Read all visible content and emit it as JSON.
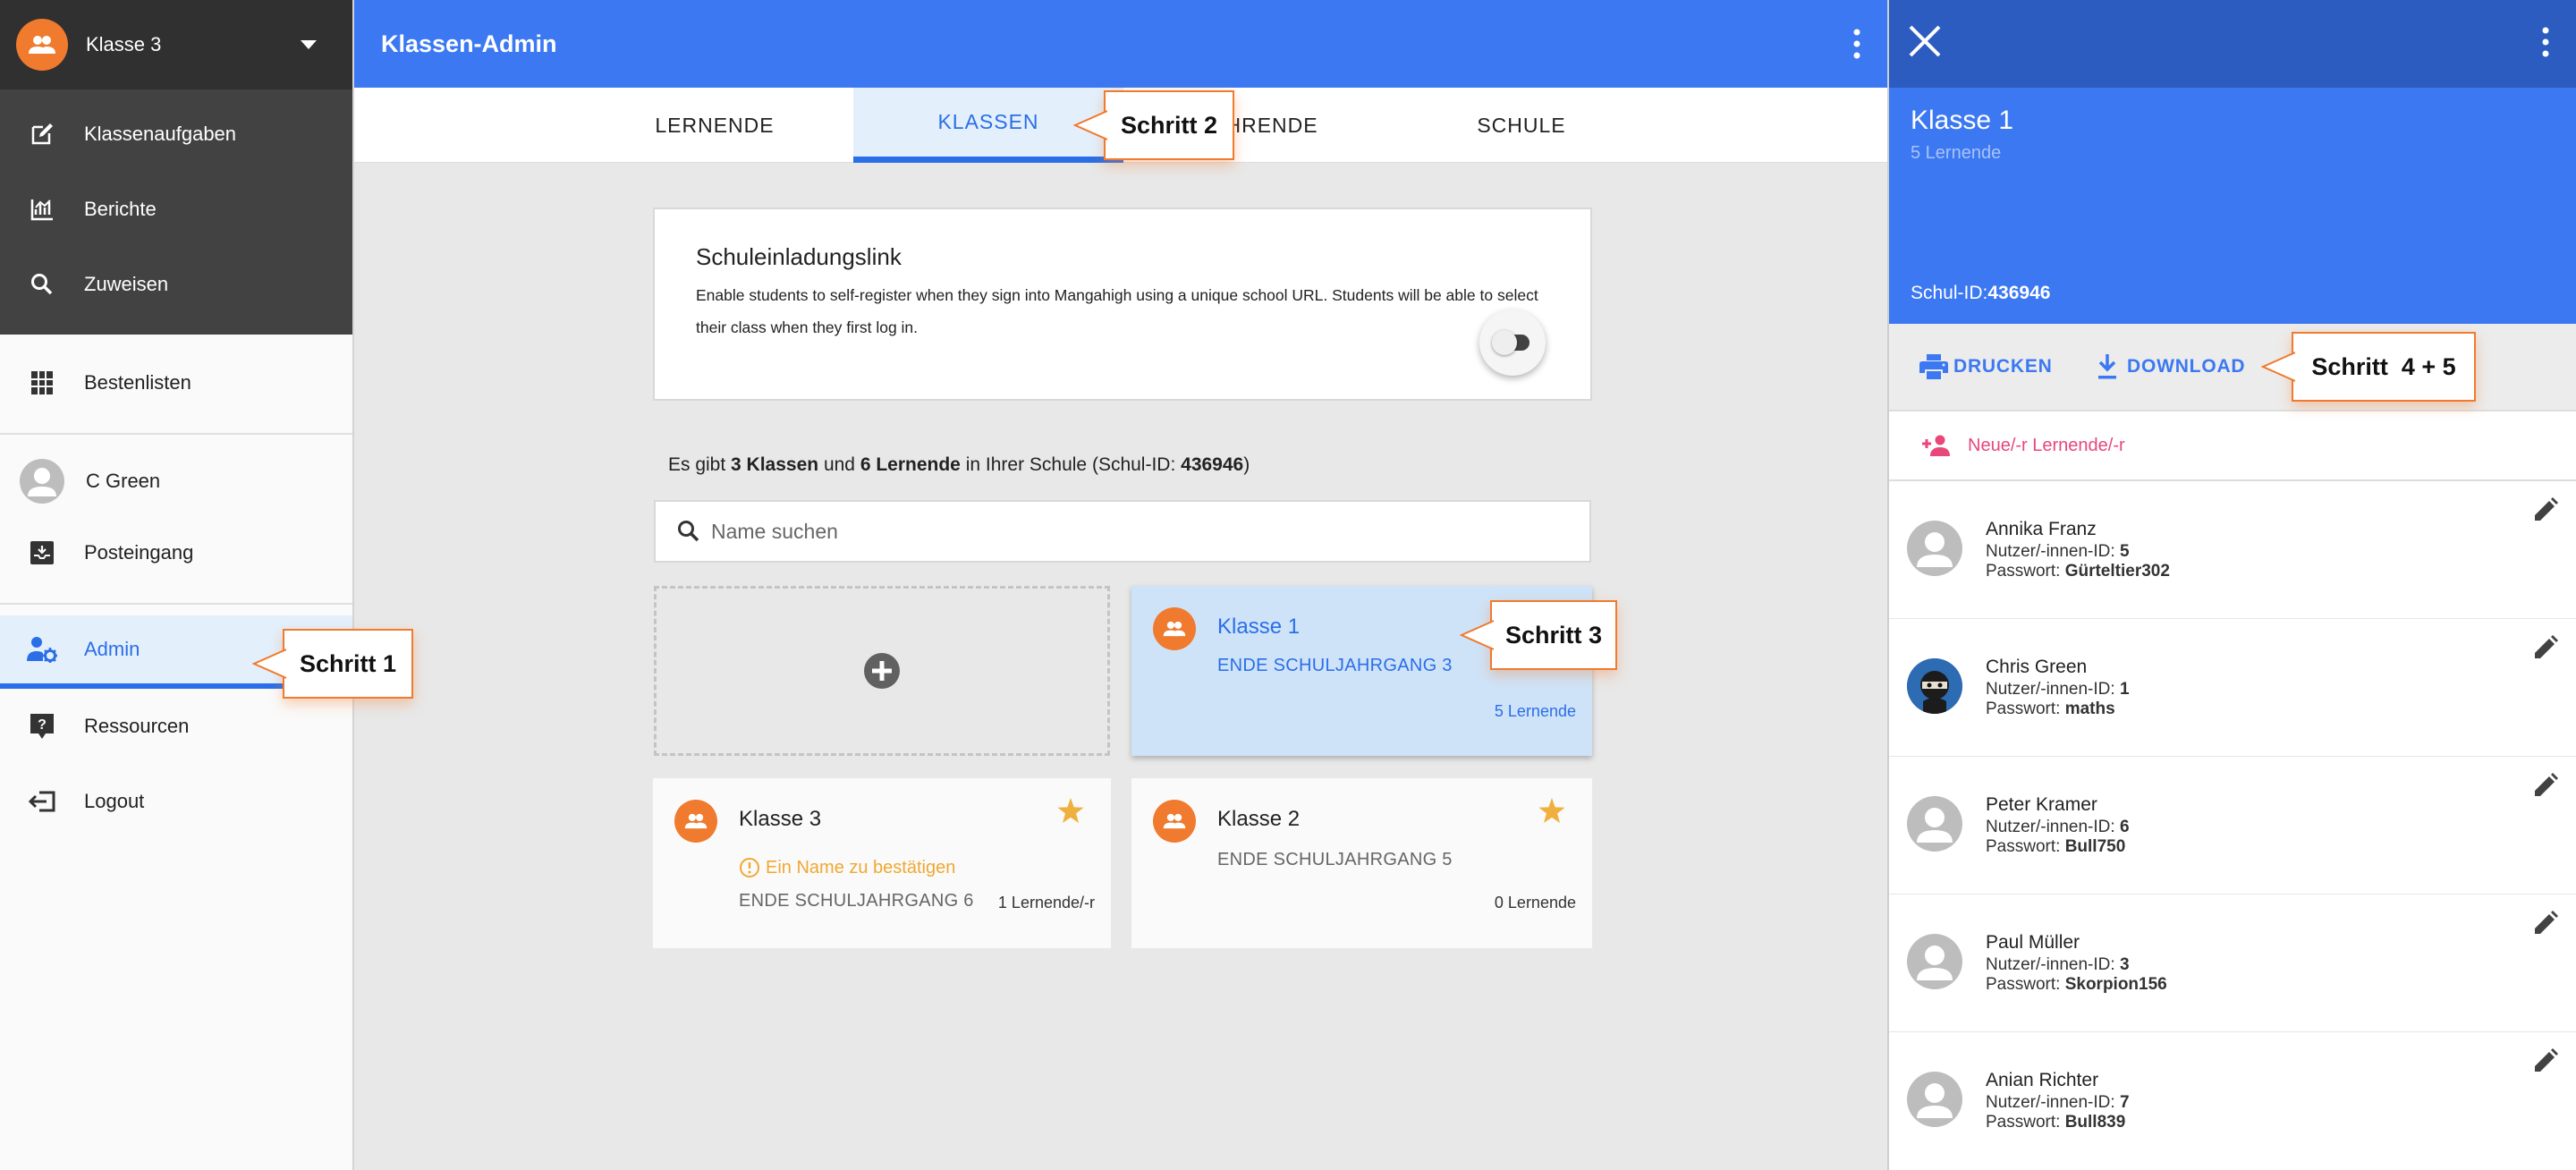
{
  "sidebar": {
    "current_class": "Klasse 3",
    "items_top": [
      {
        "label": "Klassenaufgaben",
        "icon": "edit-note-icon"
      },
      {
        "label": "Berichte",
        "icon": "bar-chart-icon"
      },
      {
        "label": "Zuweisen",
        "icon": "search-icon"
      }
    ],
    "leaderboard": "Bestenlisten",
    "user_name": "C Green",
    "inbox": "Posteingang",
    "admin": "Admin",
    "resources": "Ressourcen",
    "logout": "Logout"
  },
  "header": {
    "title": "Klassen-Admin"
  },
  "tabs": [
    "LERNENDE",
    "KLASSEN",
    "LEHRENDE",
    "SCHULE"
  ],
  "invite": {
    "title": "Schuleinladungslink",
    "description": "Enable students to self-register when they sign into Mangahigh using a unique school URL. Students will be able to select their class when they first log in.",
    "enabled": false
  },
  "summary": {
    "p1": "Es gibt ",
    "classes": "3 Klassen",
    "p2": " und ",
    "learners": "6 Lernende",
    "p3": " in Ihrer Schule (Schul-ID: ",
    "school_id": "436946",
    "p4": ")"
  },
  "search": {
    "placeholder": "Name suchen"
  },
  "classes": [
    {
      "name": "Klasse 1",
      "grade": "ENDE SCHULJAHRGANG 3",
      "count": "5 Lernende",
      "selected": true
    },
    {
      "name": "Klasse 3",
      "grade": "ENDE SCHULJAHRGANG 6",
      "count": "1 Lernende/-r",
      "warning": "Ein Name zu bestätigen",
      "starred": true
    },
    {
      "name": "Klasse 2",
      "grade": "ENDE SCHULJAHRGANG 5",
      "count": "0 Lernende",
      "starred": true
    }
  ],
  "panel": {
    "title": "Klasse 1",
    "subtitle": "5 Lernende",
    "schul_id_label": "Schul-ID:",
    "schul_id": "436946",
    "print": "DRUCKEN",
    "download": "DOWNLOAD",
    "new_learner": "Neue/-r Lernende/-r",
    "id_label": "Nutzer/-innen-ID: ",
    "pw_label": "Passwort: ",
    "students": [
      {
        "name": "Annika Franz",
        "id": "5",
        "password": "Gürteltier302"
      },
      {
        "name": "Chris Green",
        "id": "1",
        "password": "maths"
      },
      {
        "name": "Peter Kramer",
        "id": "6",
        "password": "Bull750"
      },
      {
        "name": "Paul Müller",
        "id": "3",
        "password": "Skorpion156"
      },
      {
        "name": "Anian Richter",
        "id": "7",
        "password": "Bull839"
      }
    ]
  },
  "callouts": {
    "step1": "Schritt 1",
    "step2": "Schritt 2",
    "step3": "Schritt 3",
    "step45": "Schritt  4 + 5"
  },
  "colors": {
    "primary": "#3b78f2",
    "accent_orange": "#f07a2d",
    "sidebar_dark": "#424242",
    "warning": "#f0a830",
    "pink": "#e8477a"
  }
}
